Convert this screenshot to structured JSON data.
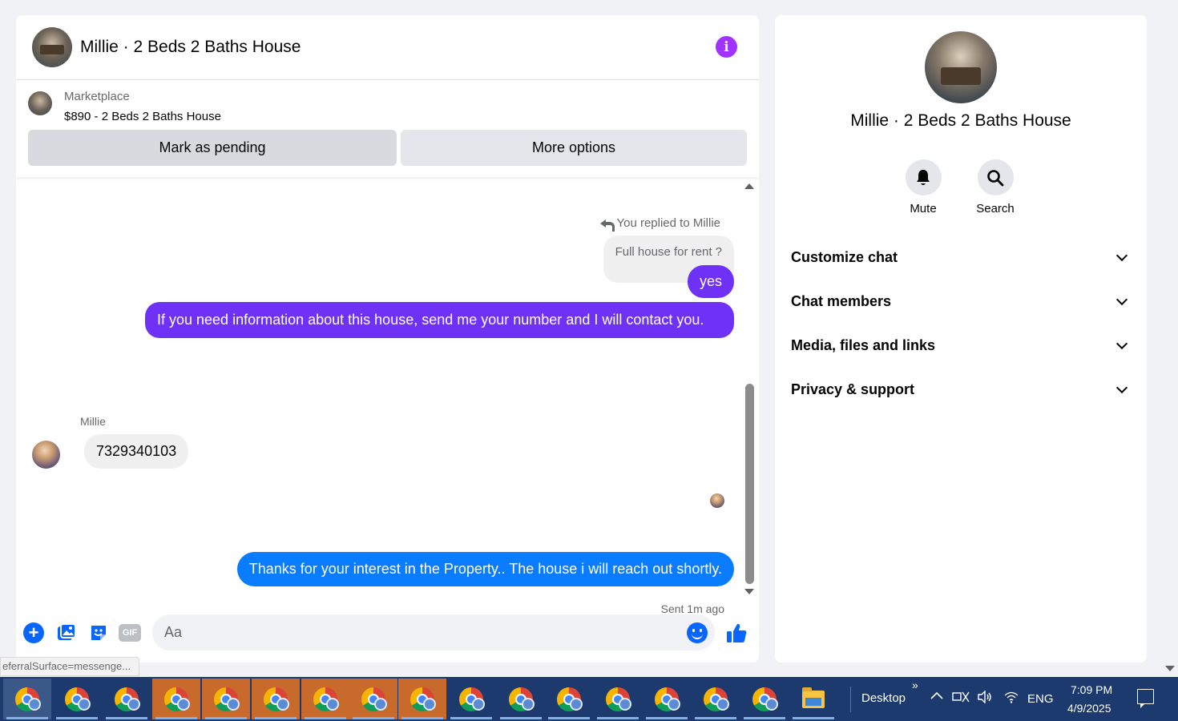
{
  "chat": {
    "title": "Millie · 2 Beds 2 Baths House",
    "marketplace_label": "Marketplace",
    "listing": "$890 - 2 Beds 2 Baths House",
    "buttons": {
      "pending": "Mark as pending",
      "more": "More options"
    }
  },
  "messages": {
    "replied_label": "You replied to Millie",
    "quoted_text": "Full house for rent ?",
    "outgoing_1": "yes",
    "outgoing_2": "If you need information about this house, send me your number and I will contact you.",
    "sender_name": "Millie",
    "incoming_1": "7329340103",
    "outgoing_3": "Thanks for your interest in the Property.. The house i will reach  out shortly.",
    "status": "Sent 1m ago"
  },
  "composer": {
    "placeholder": "Aa",
    "gif_label": "GIF"
  },
  "details": {
    "title": "Millie · 2 Beds 2 Baths House",
    "actions": {
      "mute": "Mute",
      "search": "Search"
    },
    "sections": [
      "Customize chat",
      "Chat members",
      "Media, files and links",
      "Privacy & support"
    ]
  },
  "status_url": "eferralSurface=messenge...",
  "taskbar": {
    "desktop_label": "Desktop",
    "more_label": "»",
    "language": "ENG",
    "time": "7:09 PM",
    "date": "4/9/2025"
  },
  "colors": {
    "accent_purple": "#7031f6",
    "accent_blue": "#0a7cff",
    "info_purple": "#a033ff"
  }
}
